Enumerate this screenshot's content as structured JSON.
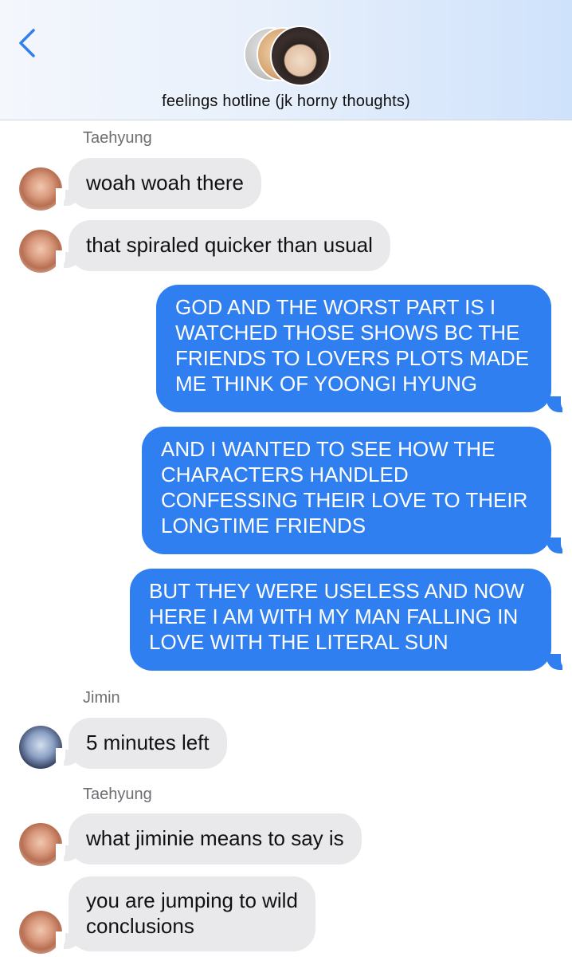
{
  "header": {
    "chat_title": "feelings hotline (jk horny thoughts)",
    "back_icon": "chevron-left-icon",
    "accent_color": "#2f7ff1"
  },
  "messages": [
    {
      "sender": "Taehyung",
      "direction": "incoming",
      "text": "woah woah there"
    },
    {
      "direction": "incoming",
      "text": "that spiraled quicker than usual"
    },
    {
      "direction": "outgoing",
      "lines": [
        "GOD AND THE WORST PART IS I",
        "WATCHED THOSE SHOWS BC THE",
        "FRIENDS TO LOVERS PLOTS MADE",
        "ME THINK OF YOONGI HYUNG"
      ]
    },
    {
      "direction": "outgoing",
      "lines": [
        "AND I WANTED TO SEE HOW THE",
        "CHARACTERS HANDLED",
        "CONFESSING THEIR LOVE TO THEIR",
        "LONGTIME FRIENDS"
      ]
    },
    {
      "direction": "outgoing",
      "lines": [
        "BUT THEY WERE USELESS AND NOW",
        "HERE I AM WITH MY MAN FALLING IN",
        "LOVE WITH THE LITERAL SUN"
      ]
    },
    {
      "sender": "Jimin",
      "direction": "incoming",
      "text": "5 minutes left"
    },
    {
      "sender": "Taehyung",
      "direction": "incoming",
      "text": "what jiminie means to say is"
    },
    {
      "direction": "incoming",
      "lines": [
        "you are jumping to wild",
        "conclusions"
      ]
    }
  ]
}
